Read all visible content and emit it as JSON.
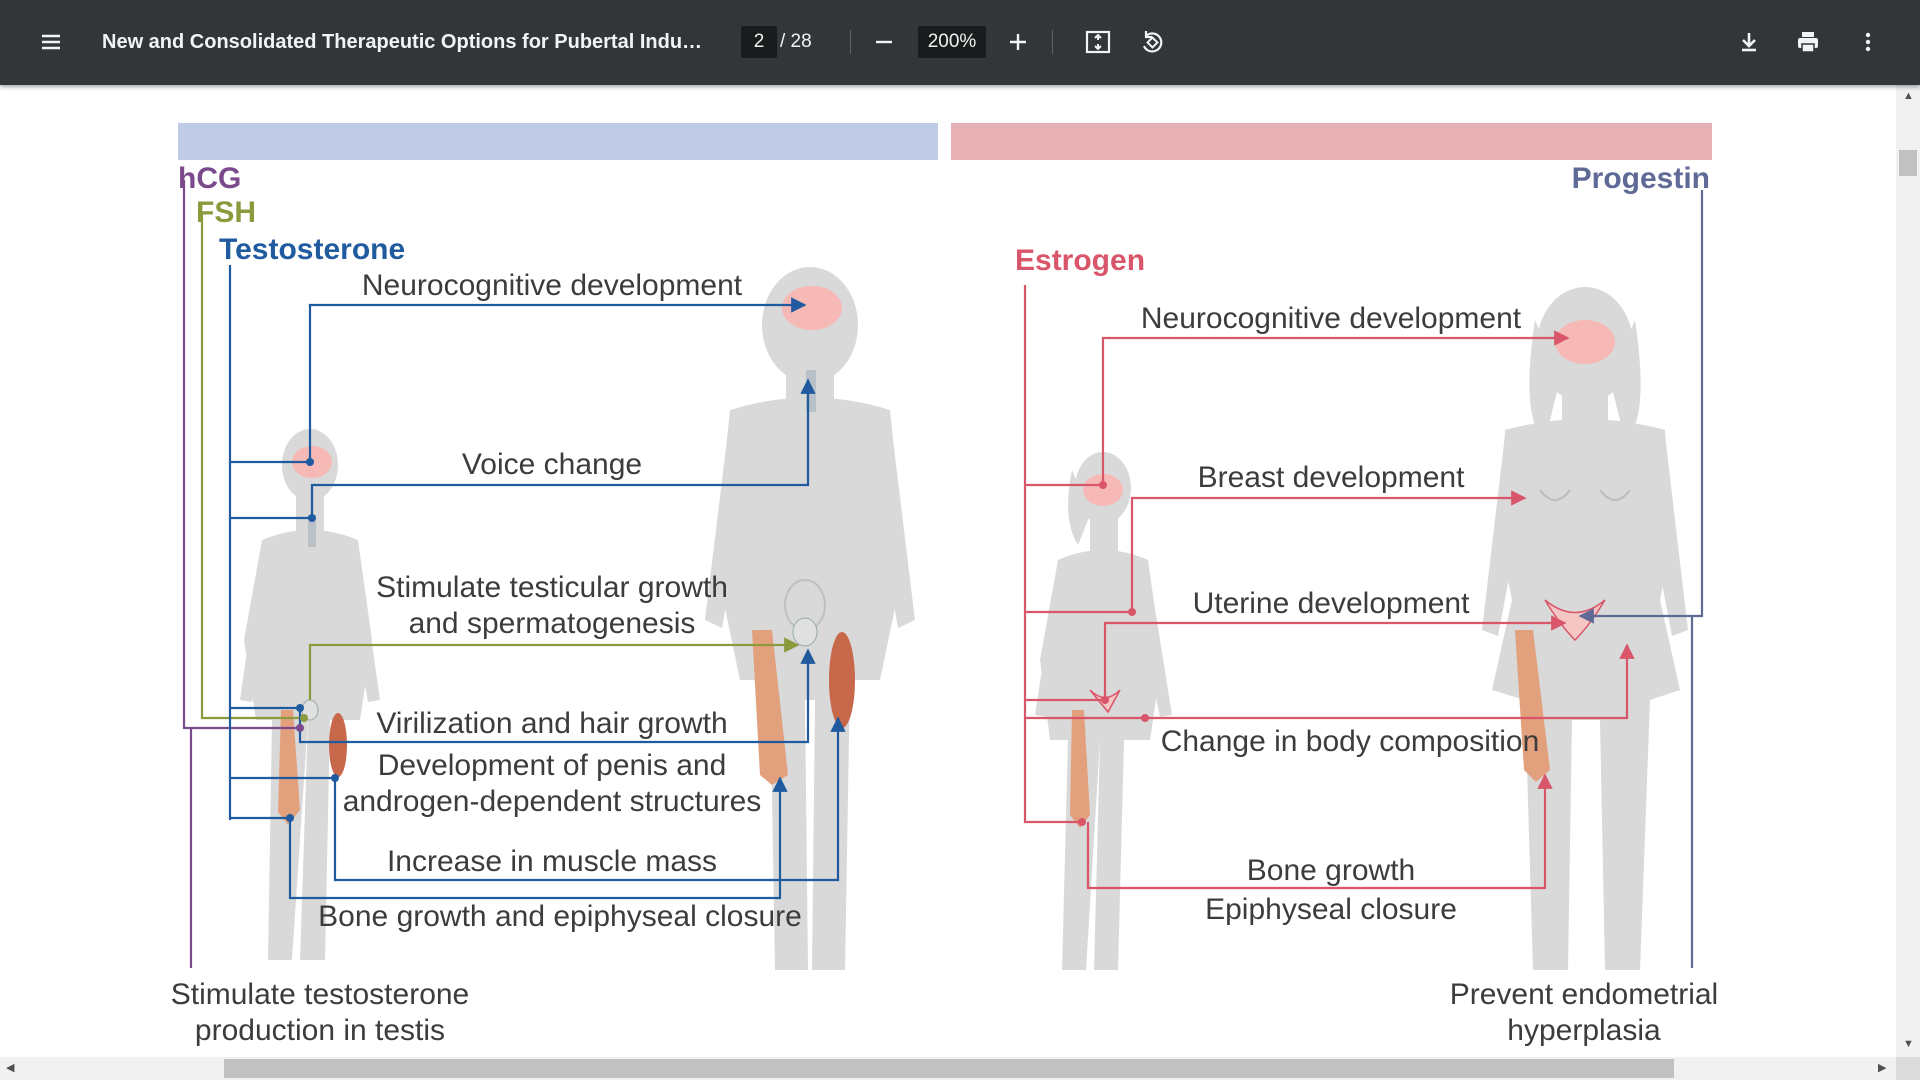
{
  "toolbar": {
    "title": "New and Consolidated Therapeutic Options for Pubertal Inducti...",
    "page_current": "2",
    "page_total": "/ 28",
    "zoom": "200%",
    "icons": [
      "menu-icon",
      "zoom-out-icon",
      "zoom-in-icon",
      "fit-page-icon",
      "rotate-icon",
      "download-icon",
      "print-icon",
      "more-icon"
    ]
  },
  "figure": {
    "male": {
      "hormones": [
        "hCG",
        "FSH",
        "Testosterone"
      ],
      "effects": {
        "neuro": "Neurocognitive development",
        "voice": "Voice change",
        "testis_1": "Stimulate testicular growth",
        "testis_2": "and spermatogenesis",
        "viril": "Virilization and hair growth",
        "penis_1": "Development of penis and",
        "penis_2": "androgen-dependent structures",
        "muscle": "Increase in muscle mass",
        "bone": "Bone growth and epiphyseal closure",
        "hcg_1": "Stimulate testosterone",
        "hcg_2": "production in testis"
      }
    },
    "female": {
      "hormones": [
        "Estrogen",
        "Progestin"
      ],
      "effects": {
        "neuro": "Neurocognitive development",
        "breast": "Breast development",
        "uterine": "Uterine development",
        "body": "Change in body composition",
        "bone_1": "Bone growth",
        "bone_2": "Epiphyseal closure",
        "prog_1": "Prevent endometrial",
        "prog_2": "hyperplasia"
      }
    },
    "colors": {
      "male_band": "#c0cbe6",
      "female_band": "#e8b1b5",
      "hcg": "#7b4a8c",
      "fsh": "#8a9a3c",
      "testosterone": "#1f5b9e",
      "estrogen": "#d9556a",
      "progestin": "#5f6a96",
      "silhouette": "#d9d9d9",
      "brain": "#f6b9b5"
    }
  }
}
